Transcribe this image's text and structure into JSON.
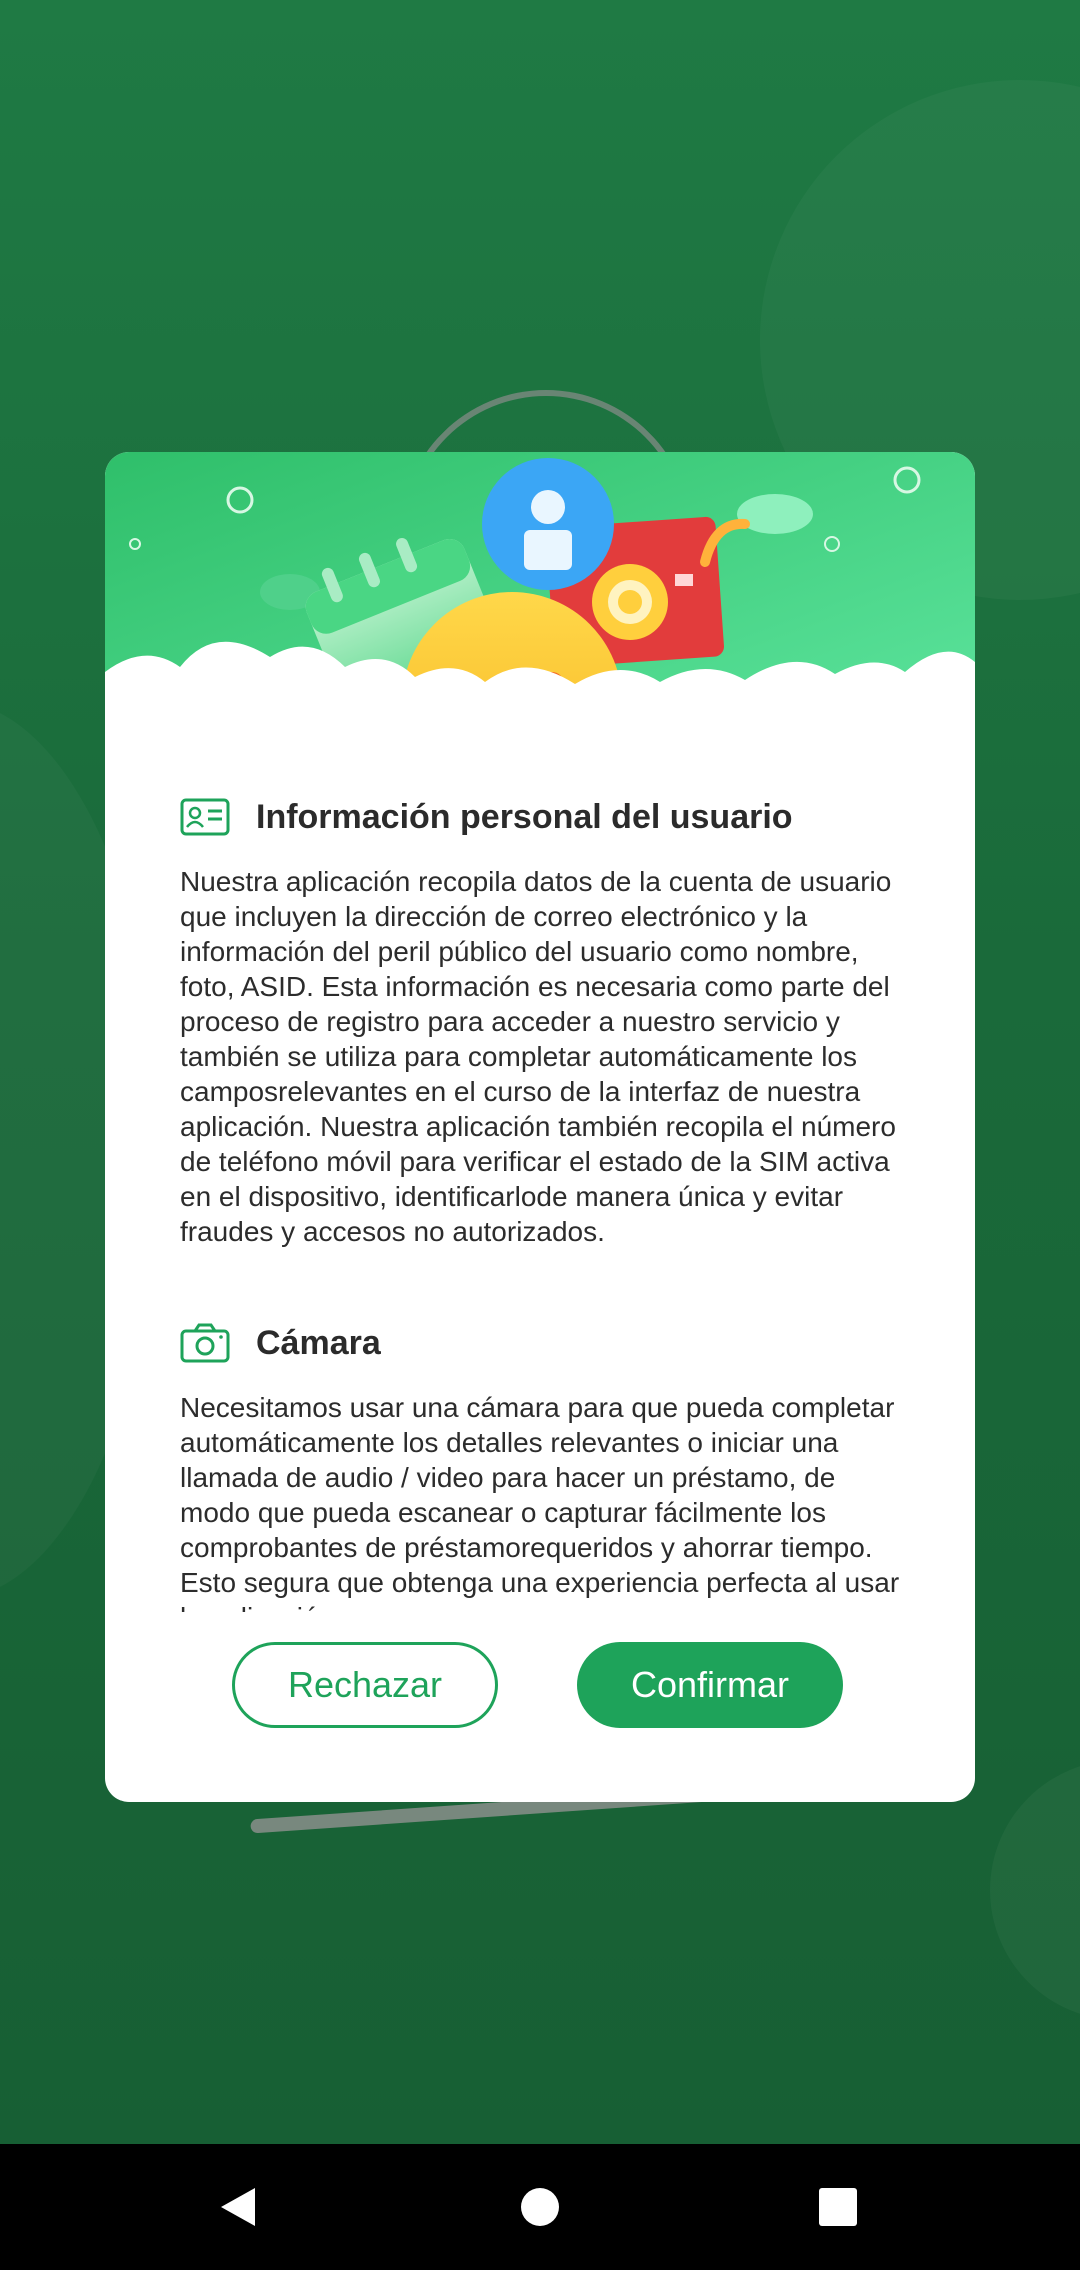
{
  "sections": [
    {
      "icon": "id-card-icon",
      "title": "Información personal del usuario",
      "body": "Nuestra aplicación recopila datos de la cuenta de usuario que incluyen la dirección de correo electrónico y la información del peril público del usuario como nombre, foto, ASID. Esta información es necesaria como parte del proceso de registro para acceder a nuestro servicio y también se utiliza para completar automáticamente los camposrelevantes en el curso de la interfaz de nuestra aplicación. Nuestra aplicación también recopila el número de teléfono móvil para verificar el estado de la SIM activa en el dispositivo, identificarlode manera única y evitar fraudes y accesos no autorizados."
    },
    {
      "icon": "camera-icon",
      "title": "Cámara",
      "body": "Necesitamos usar una cámara para que pueda completar automáticamente los detalles relevantes o iniciar una llamada de audio / video para hacer un préstamo, de modo que pueda escanear o capturar fácilmente los comprobantes de préstamorequeridos y ahorrar tiempo. Esto segura que obtenga una experiencia perfecta al usar la aplicación."
    }
  ],
  "buttons": {
    "reject": "Rechazar",
    "confirm": "Confirmar"
  },
  "colors": {
    "accent": "#1ea35a",
    "background": "#1c6a3c"
  },
  "navbar": {
    "back": "back-icon",
    "home": "home-icon",
    "recents": "recents-icon"
  }
}
